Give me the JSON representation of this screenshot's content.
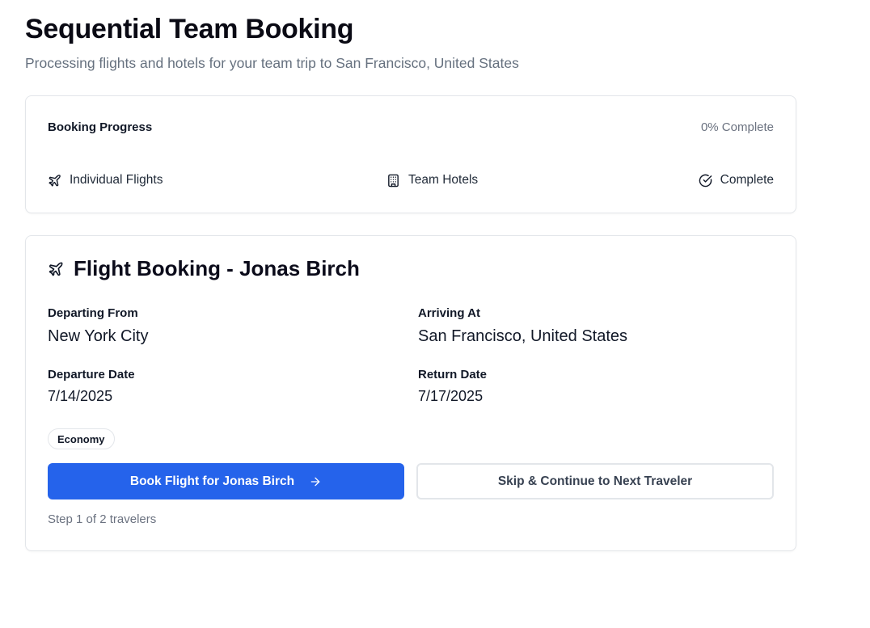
{
  "header": {
    "title": "Sequential Team Booking",
    "subtitle": "Processing flights and hotels for your team trip to San Francisco, United States"
  },
  "progress": {
    "label": "Booking Progress",
    "percent_text": "0% Complete",
    "percent_value": 0,
    "steps": [
      {
        "label": "Individual Flights",
        "icon": "plane-icon"
      },
      {
        "label": "Team Hotels",
        "icon": "building-icon"
      },
      {
        "label": "Complete",
        "icon": "check-circle-icon"
      }
    ]
  },
  "booking": {
    "title": "Flight Booking - Jonas Birch",
    "title_icon": "plane-icon",
    "departing_label": "Departing From",
    "departing_value": "New York City",
    "arriving_label": "Arriving At",
    "arriving_value": "San Francisco, United States",
    "departure_date_label": "Departure Date",
    "departure_date_value": "7/14/2025",
    "return_date_label": "Return Date",
    "return_date_value": "7/17/2025",
    "class_badge": "Economy",
    "primary_button": "Book Flight for Jonas Birch",
    "primary_button_icon": "arrow-right-icon",
    "secondary_button": "Skip & Continue to Next Traveler",
    "step_note": "Step 1 of 2 travelers"
  },
  "colors": {
    "primary": "#2563eb",
    "muted_text": "#6b7280",
    "border": "#e3e6ea"
  }
}
